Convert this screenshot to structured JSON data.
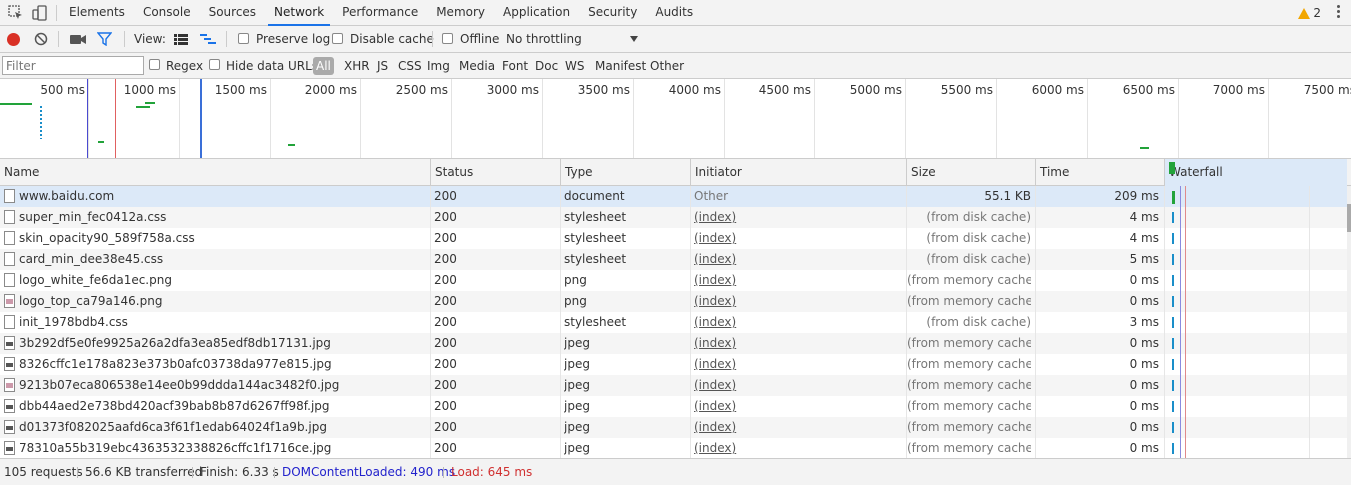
{
  "tabs": [
    "Elements",
    "Console",
    "Sources",
    "Network",
    "Performance",
    "Memory",
    "Application",
    "Security",
    "Audits"
  ],
  "active_tab": "Network",
  "warning_count": "2",
  "toolbar": {
    "view_label": "View:",
    "preserve_log": "Preserve log",
    "disable_cache": "Disable cache",
    "offline": "Offline",
    "throttling": "No throttling"
  },
  "filterbar": {
    "placeholder": "Filter",
    "regex": "Regex",
    "hide_data_urls": "Hide data URLs",
    "all": "All",
    "types": [
      "XHR",
      "JS",
      "CSS",
      "Img",
      "Media",
      "Font",
      "Doc",
      "WS",
      "Manifest",
      "Other"
    ]
  },
  "overview_ticks": [
    "500 ms",
    "1000 ms",
    "1500 ms",
    "2000 ms",
    "2500 ms",
    "3000 ms",
    "3500 ms",
    "4000 ms",
    "4500 ms",
    "5000 ms",
    "5500 ms",
    "6000 ms",
    "6500 ms",
    "7000 ms",
    "7500 ms"
  ],
  "columns": [
    "Name",
    "Status",
    "Type",
    "Initiator",
    "Size",
    "Time",
    "Waterfall"
  ],
  "rows": [
    {
      "name": "www.baidu.com",
      "status": "200",
      "type": "document",
      "initiator": "Other",
      "size": "55.1 KB",
      "time": "209 ms",
      "icon": "doc"
    },
    {
      "name": "super_min_fec0412a.css",
      "status": "200",
      "type": "stylesheet",
      "initiator": "(index)",
      "size": "(from disk cache)",
      "time": "4 ms",
      "icon": "doc"
    },
    {
      "name": "skin_opacity90_589f758a.css",
      "status": "200",
      "type": "stylesheet",
      "initiator": "(index)",
      "size": "(from disk cache)",
      "time": "4 ms",
      "icon": "doc"
    },
    {
      "name": "card_min_dee38e45.css",
      "status": "200",
      "type": "stylesheet",
      "initiator": "(index)",
      "size": "(from disk cache)",
      "time": "5 ms",
      "icon": "doc"
    },
    {
      "name": "logo_white_fe6da1ec.png",
      "status": "200",
      "type": "png",
      "initiator": "(index)",
      "size": "(from memory cache)",
      "time": "0 ms",
      "icon": "doc"
    },
    {
      "name": "logo_top_ca79a146.png",
      "status": "200",
      "type": "png",
      "initiator": "(index)",
      "size": "(from memory cache)",
      "time": "0 ms",
      "icon": "img2"
    },
    {
      "name": "init_1978bdb4.css",
      "status": "200",
      "type": "stylesheet",
      "initiator": "(index)",
      "size": "(from disk cache)",
      "time": "3 ms",
      "icon": "doc"
    },
    {
      "name": "3b292df5e0fe9925a26a2dfa3ea85edf8db17131.jpg",
      "status": "200",
      "type": "jpeg",
      "initiator": "(index)",
      "size": "(from memory cache)",
      "time": "0 ms",
      "icon": "img"
    },
    {
      "name": "8326cffc1e178a823e373b0afc03738da977e815.jpg",
      "status": "200",
      "type": "jpeg",
      "initiator": "(index)",
      "size": "(from memory cache)",
      "time": "0 ms",
      "icon": "img"
    },
    {
      "name": "9213b07eca806538e14ee0b99ddda144ac3482f0.jpg",
      "status": "200",
      "type": "jpeg",
      "initiator": "(index)",
      "size": "(from memory cache)",
      "time": "0 ms",
      "icon": "img2"
    },
    {
      "name": "dbb44aed2e738bd420acf39bab8b87d6267ff98f.jpg",
      "status": "200",
      "type": "jpeg",
      "initiator": "(index)",
      "size": "(from memory cache)",
      "time": "0 ms",
      "icon": "img"
    },
    {
      "name": "d01373f082025aafd6ca3f61f1edab64024f1a9b.jpg",
      "status": "200",
      "type": "jpeg",
      "initiator": "(index)",
      "size": "(from memory cache)",
      "time": "0 ms",
      "icon": "img"
    },
    {
      "name": "78310a55b319ebc4363532338826cffc1f1716ce.jpg",
      "status": "200",
      "type": "jpeg",
      "initiator": "(index)",
      "size": "(from memory cache)",
      "time": "0 ms",
      "icon": "img"
    }
  ],
  "status": {
    "requests": "105 requests",
    "transferred": "56.6 KB transferred",
    "finish": "Finish: 6.33 s",
    "dcl": "DOMContentLoaded: 490 ms",
    "load": "Load: 645 ms"
  },
  "colors": {
    "accent": "#1a73e8",
    "record": "#d93025",
    "dcl": "#2222cc",
    "load": "#d03030",
    "bar": "#22a33a"
  }
}
